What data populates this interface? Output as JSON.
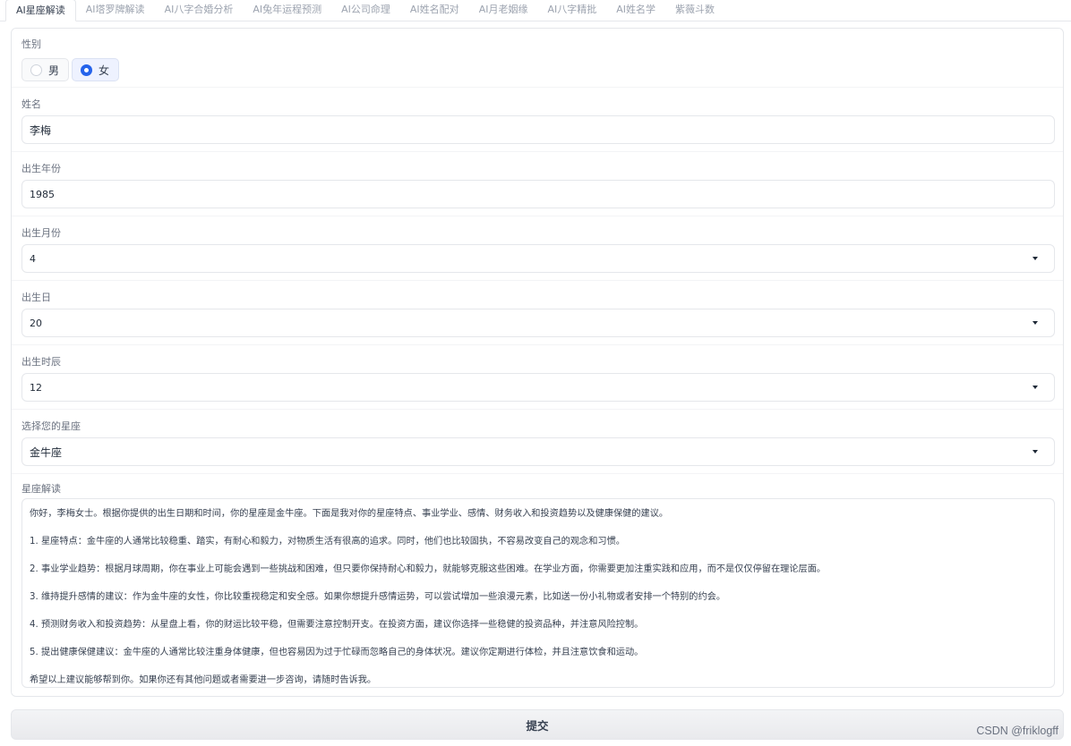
{
  "tabs": [
    "AI星座解读",
    "AI塔罗牌解读",
    "AI八字合婚分析",
    "AI兔年运程预测",
    "AI公司命理",
    "AI姓名配对",
    "AI月老姻缘",
    "AI八字精批",
    "AI姓名学",
    "紫薇斗数"
  ],
  "gender": {
    "label": "性别",
    "options": [
      "男",
      "女"
    ],
    "selected": "女"
  },
  "name": {
    "label": "姓名",
    "value": "李梅"
  },
  "birth_year": {
    "label": "出生年份",
    "value": "1985"
  },
  "birth_month": {
    "label": "出生月份",
    "value": "4"
  },
  "birth_day": {
    "label": "出生日",
    "value": "20"
  },
  "birth_hour": {
    "label": "出生时辰",
    "value": "12"
  },
  "zodiac": {
    "label": "选择您的星座",
    "value": "金牛座"
  },
  "reading": {
    "label": "星座解读",
    "paragraphs": [
      "你好，李梅女士。根据你提供的出生日期和时间，你的星座是金牛座。下面是我对你的星座特点、事业学业、感情、财务收入和投资趋势以及健康保健的建议。",
      "1. 星座特点：金牛座的人通常比较稳重、踏实，有耐心和毅力，对物质生活有很高的追求。同时，他们也比较固执，不容易改变自己的观念和习惯。",
      "2. 事业学业趋势：根据月球周期，你在事业上可能会遇到一些挑战和困难，但只要你保持耐心和毅力，就能够克服这些困难。在学业方面，你需要更加注重实践和应用，而不是仅仅停留在理论层面。",
      "3. 维持提升感情的建议：作为金牛座的女性，你比较重视稳定和安全感。如果你想提升感情运势，可以尝试增加一些浪漫元素，比如送一份小礼物或者安排一个特别的约会。",
      "4. 预测财务收入和投资趋势：从星盘上看，你的财运比较平稳，但需要注意控制开支。在投资方面，建议你选择一些稳健的投资品种，并注意风险控制。",
      "5. 提出健康保健建议：金牛座的人通常比较注重身体健康，但也容易因为过于忙碌而忽略自己的身体状况。建议你定期进行体检，并且注意饮食和运动。",
      "希望以上建议能够帮到你。如果你还有其他问题或者需要进一步咨询，请随时告诉我。"
    ]
  },
  "submit_label": "提交",
  "watermark": "CSDN @friklogff"
}
